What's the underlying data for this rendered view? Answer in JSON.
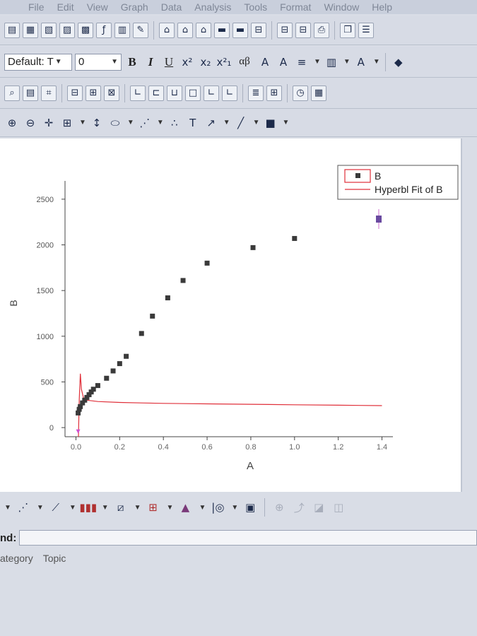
{
  "menu": [
    "File",
    "Edit",
    "View",
    "Graph",
    "Data",
    "Analysis",
    "Tools",
    "Format",
    "Window",
    "Help"
  ],
  "format_toolbar": {
    "font_name": "Default: T",
    "font_size": "0",
    "bold": "B",
    "italic": "I",
    "underline": "U",
    "greek": "αβ"
  },
  "toolbar_icons": {
    "row1": [
      "new-project-icon",
      "new-worksheet-icon",
      "new-graph-icon",
      "new-matrix-icon",
      "new-excel-icon",
      "new-function-icon",
      "new-layout-icon",
      "new-notes-icon",
      "open-icon",
      "open-template-icon",
      "open-excel-icon",
      "save-project-icon",
      "save-template-icon",
      "import-ascii-icon",
      "import-multiple-icon",
      "import-wizard-icon",
      "print-icon",
      "copy-page-icon",
      "refresh-icon"
    ],
    "row3": [
      "project-explorer-icon",
      "results-log-icon",
      "code-builder-icon",
      "merge-icon",
      "split-icon",
      "arrange-icon",
      "layer-icon",
      "layer-2-icon",
      "layer-3-icon",
      "layer-4-icon",
      "layer-5-icon",
      "layer-6-icon",
      "rescale-icon",
      "add-layer-icon",
      "timer-icon",
      "grid-icon"
    ],
    "row4": [
      "zoom-in-icon",
      "zoom-out-icon",
      "data-reader-icon",
      "screen-reader-icon",
      "scale-icon",
      "mask-icon",
      "draw-data-icon",
      "regional-data-icon",
      "text-tool-icon",
      "arrow-tool-icon",
      "line-tool-icon",
      "rectangle-tool-icon"
    ]
  },
  "status": {
    "command_label": "nd:",
    "tabs": [
      "ategory",
      "Topic"
    ]
  },
  "chart_data": {
    "type": "scatter",
    "xlabel": "A",
    "ylabel": "B",
    "xlim": [
      -0.05,
      1.45
    ],
    "ylim": [
      -100,
      2700
    ],
    "x_ticks": [
      "0.0",
      "0.2",
      "0.4",
      "0.6",
      "0.8",
      "1.0",
      "1.2",
      "1.4"
    ],
    "x_tick_values": [
      0.0,
      0.2,
      0.4,
      0.6,
      0.8,
      1.0,
      1.2,
      1.4
    ],
    "y_ticks": [
      "0",
      "500",
      "1000",
      "1500",
      "2000",
      "2500"
    ],
    "y_tick_values": [
      0,
      500,
      1000,
      1500,
      2000,
      2500
    ],
    "legend": {
      "position": "top-right",
      "entries": [
        "B",
        "Hyperbl Fit of B"
      ]
    },
    "series": [
      {
        "name": "B",
        "kind": "scatter",
        "color": "#3a3a3a",
        "points": [
          [
            0.01,
            160
          ],
          [
            0.015,
            200
          ],
          [
            0.02,
            230
          ],
          [
            0.03,
            270
          ],
          [
            0.04,
            300
          ],
          [
            0.05,
            330
          ],
          [
            0.06,
            360
          ],
          [
            0.07,
            390
          ],
          [
            0.08,
            420
          ],
          [
            0.1,
            460
          ],
          [
            0.14,
            540
          ],
          [
            0.17,
            620
          ],
          [
            0.2,
            700
          ],
          [
            0.23,
            780
          ],
          [
            0.3,
            1030
          ],
          [
            0.35,
            1220
          ],
          [
            0.42,
            1420
          ],
          [
            0.49,
            1610
          ],
          [
            0.6,
            1800
          ],
          [
            0.81,
            1970
          ],
          [
            1.0,
            2070
          ]
        ]
      },
      {
        "name": "Hyperbl Fit of B",
        "kind": "line",
        "color": "#e0303a",
        "points": [
          [
            0.01,
            -250
          ],
          [
            0.015,
            300
          ],
          [
            0.02,
            590
          ],
          [
            0.025,
            420
          ],
          [
            0.035,
            320
          ],
          [
            0.05,
            300
          ],
          [
            0.1,
            285
          ],
          [
            0.2,
            275
          ],
          [
            0.3,
            270
          ],
          [
            0.4,
            265
          ],
          [
            0.6,
            260
          ],
          [
            0.8,
            255
          ],
          [
            1.0,
            250
          ],
          [
            1.2,
            245
          ],
          [
            1.4,
            240
          ]
        ]
      }
    ]
  }
}
